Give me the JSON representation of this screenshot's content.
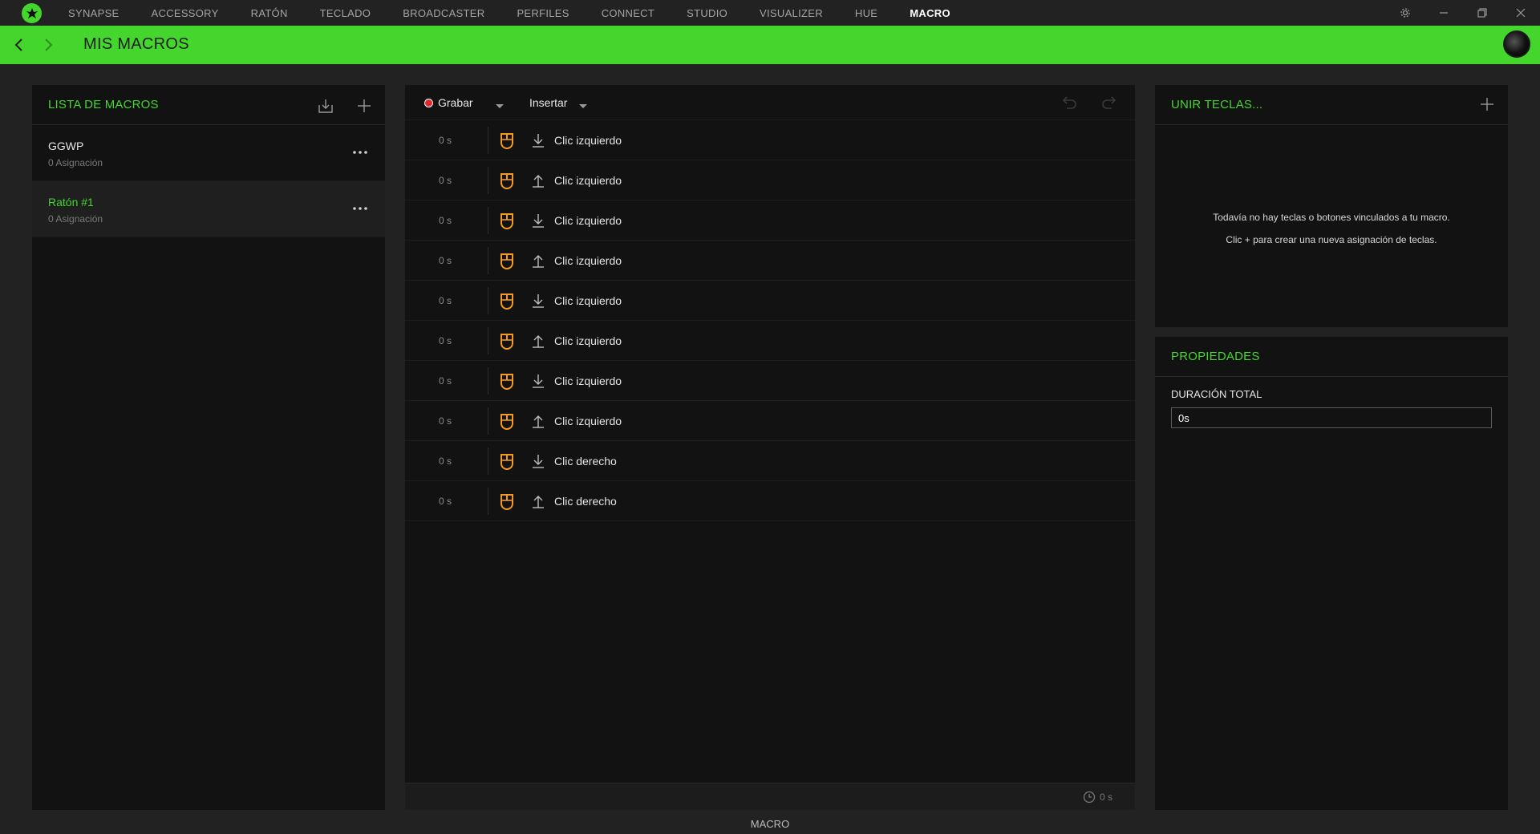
{
  "app": {
    "tabs": [
      "SYNAPSE",
      "ACCESSORY",
      "RATÓN",
      "TECLADO",
      "BROADCASTER",
      "PERFILES",
      "CONNECT",
      "STUDIO",
      "VISUALIZER",
      "HUE",
      "MACRO"
    ],
    "active_tab": "MACRO",
    "window_controls": [
      "gear-icon",
      "minimize-icon",
      "restore-icon",
      "close-icon"
    ]
  },
  "header": {
    "title": "MIS MACROS"
  },
  "macro_list": {
    "title": "LISTA DE MACROS",
    "items": [
      {
        "name": "GGWP",
        "sub": "0 Asignación"
      },
      {
        "name": "Ratón #1",
        "sub": "0 Asignación"
      }
    ]
  },
  "editor": {
    "record_label": "Grabar",
    "insert_label": "Insertar",
    "rows": [
      {
        "delay": "0 s",
        "direction": "down",
        "label": "Clic izquierdo"
      },
      {
        "delay": "0 s",
        "direction": "up",
        "label": "Clic izquierdo"
      },
      {
        "delay": "0 s",
        "direction": "down",
        "label": "Clic izquierdo"
      },
      {
        "delay": "0 s",
        "direction": "up",
        "label": "Clic izquierdo"
      },
      {
        "delay": "0 s",
        "direction": "down",
        "label": "Clic izquierdo"
      },
      {
        "delay": "0 s",
        "direction": "up",
        "label": "Clic izquierdo"
      },
      {
        "delay": "0 s",
        "direction": "down",
        "label": "Clic izquierdo"
      },
      {
        "delay": "0 s",
        "direction": "up",
        "label": "Clic izquierdo"
      },
      {
        "delay": "0 s",
        "direction": "down",
        "label": "Clic derecho"
      },
      {
        "delay": "0 s",
        "direction": "up",
        "label": "Clic derecho"
      }
    ],
    "total_time": "0 s"
  },
  "bind_keys": {
    "title": "UNIR TECLAS...",
    "empty_line1": "Todavía no hay teclas o botones vinculados a tu macro.",
    "empty_line2": "Clic + para crear una nueva asignación de teclas."
  },
  "properties": {
    "title": "PROPIEDADES",
    "duration_label": "DURACIÓN TOTAL",
    "duration_value": "0s"
  },
  "status_bar": {
    "text": "MACRO"
  },
  "colors": {
    "accent": "#44d62c",
    "mouse_icon": "#f59a1f",
    "record": "#e0272c"
  }
}
